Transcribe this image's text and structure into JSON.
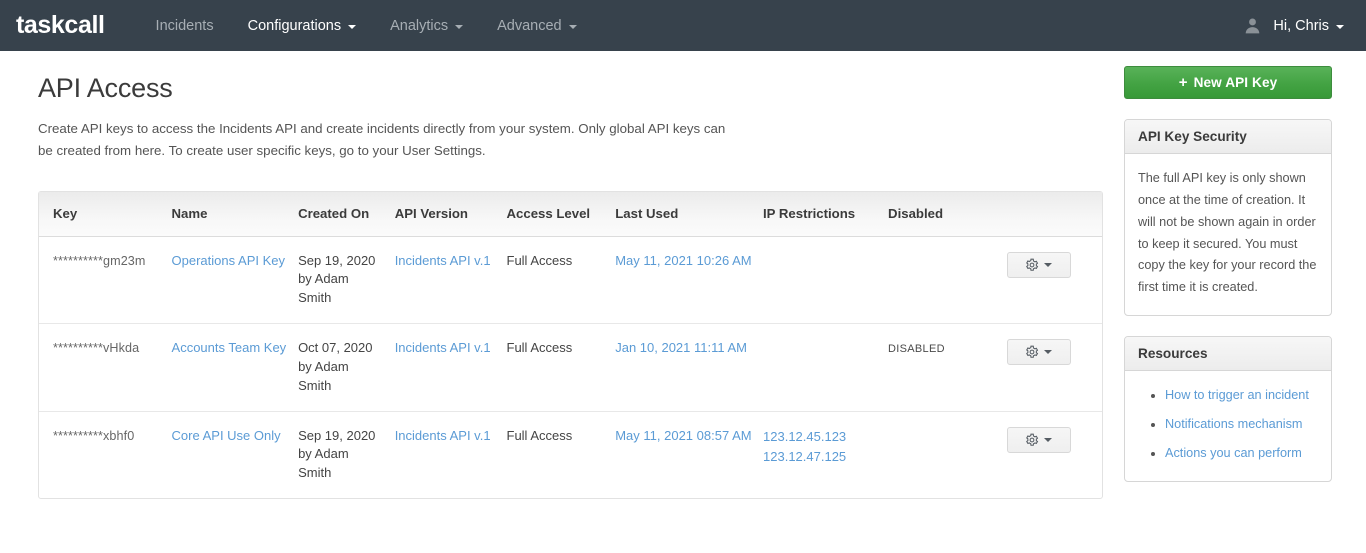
{
  "navbar": {
    "brand": "taskcall",
    "items": [
      {
        "label": "Incidents",
        "has_caret": false,
        "active": false
      },
      {
        "label": "Configurations",
        "has_caret": true,
        "active": true
      },
      {
        "label": "Analytics",
        "has_caret": true,
        "active": false
      },
      {
        "label": "Advanced",
        "has_caret": true,
        "active": false
      }
    ],
    "user_greeting": "Hi, Chris",
    "avatar_icon": "user-avatar-icon",
    "background_color": "#37424c"
  },
  "main": {
    "title": "API Access",
    "description": "Create API keys to access the Incidents API and create incidents directly from your system. Only global API keys can be created from here. To create user specific keys, go to your User Settings.",
    "table": {
      "headers": [
        "Key",
        "Name",
        "Created On",
        "API Version",
        "Access Level",
        "Last Used",
        "IP Restrictions",
        "Disabled",
        ""
      ],
      "rows": [
        {
          "key": "**********gm23m",
          "name": "Operations API Key",
          "created_on": "Sep 19, 2020 by Adam Smith",
          "api_version": "Incidents API v.1",
          "access_level": "Full Access",
          "last_used": "May 11, 2021 10:26 AM",
          "ip_restrictions": [],
          "disabled": "",
          "action_icon": "gear-icon"
        },
        {
          "key": "**********vHkda",
          "name": "Accounts Team Key",
          "created_on": "Oct 07, 2020 by Adam Smith",
          "api_version": "Incidents API v.1",
          "access_level": "Full Access",
          "last_used": "Jan 10, 2021 11:11 AM",
          "ip_restrictions": [],
          "disabled": "DISABLED",
          "action_icon": "gear-icon"
        },
        {
          "key": "**********xbhf0",
          "name": "Core API Use Only",
          "created_on": "Sep 19, 2020 by Adam Smith",
          "api_version": "Incidents API v.1",
          "access_level": "Full Access",
          "last_used": "May 11, 2021 08:57 AM",
          "ip_restrictions": [
            "123.12.45.123",
            "123.12.47.125"
          ],
          "disabled": "",
          "action_icon": "gear-icon"
        }
      ]
    }
  },
  "sidebar": {
    "new_key_button": {
      "label": "New API Key",
      "icon": "plus-icon",
      "color": "#43a343"
    },
    "security_panel": {
      "title": "API Key Security",
      "body": "The full API key is only shown once at the time of creation. It will not be shown again in order to keep it secured. You must copy the key for your record the first time it is created."
    },
    "resources_panel": {
      "title": "Resources",
      "links": [
        "How to trigger an incident",
        "Notifications mechanism",
        "Actions you can perform"
      ]
    }
  },
  "colors": {
    "link": "#5b9bd5",
    "nav_bg": "#37424c",
    "accent_green": "#43a343"
  }
}
